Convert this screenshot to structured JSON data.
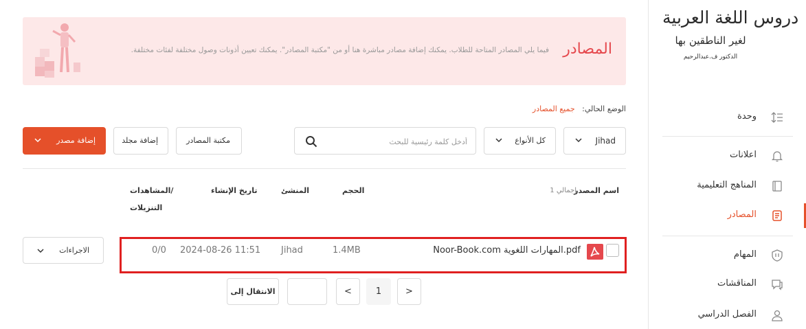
{
  "sidebar": {
    "logo": {
      "main": "دروس اللغة العربية",
      "sub": "لغير الناطقين بها",
      "author": "الدكتور ف.عبدالرحيم"
    },
    "items": [
      {
        "label": "وحدة",
        "icon": "list-sort-icon"
      },
      {
        "label": "اعلانات",
        "icon": "bell-icon"
      },
      {
        "label": "المناهج التعليمية",
        "icon": "book-icon"
      },
      {
        "label": "المصادر",
        "icon": "resources-icon",
        "active": true
      },
      {
        "label": "المهام",
        "icon": "shield-icon"
      },
      {
        "label": "المناقشات",
        "icon": "chat-icon"
      },
      {
        "label": "الفصل الدراسي",
        "icon": "user-icon"
      }
    ]
  },
  "banner": {
    "title": "المصادر",
    "description": "فيما يلي المصادر المتاحة للطلاب. يمكنك إضافة مصادر مباشرة هنا أو من \"مكتبة المصادر\". يمكنك تعيين أذونات وصول مختلفة لفئات مختلفة."
  },
  "breadcrumb": {
    "label": "الوضع الحالي:",
    "current": "جميع المصادر"
  },
  "toolbar": {
    "add_resource": "إضافة مصدر",
    "add_folder": "إضافة مجلد",
    "library": "مكتبة المصادر",
    "search_placeholder": "أدخل كلمة رئيسية للبحث",
    "type_filter": "كل الأنواع",
    "user_filter": "Jihad"
  },
  "table": {
    "headers": {
      "name": "اسم المصدر",
      "total": "إجمالي 1",
      "size": "الحجم",
      "creator": "المنشئ",
      "created": "تاريخ الإنشاء",
      "views_line1": "المشاهدات/",
      "views_line2": "التنزيلات"
    },
    "rows": [
      {
        "name": "Noor-Book.com المهارات اللغوية.pdf",
        "size": "1.4MB",
        "creator": "Jihad",
        "created": "2024-08-26 11:51",
        "views": "0/0",
        "actions": "الاجراءات"
      }
    ]
  },
  "pagination": {
    "prev": "<",
    "next": ">",
    "current": "1",
    "goto": "الانتقال إلى"
  },
  "colors": {
    "accent": "#e5502a",
    "banner_bg": "#fde8e8",
    "highlight": "#e02020"
  }
}
